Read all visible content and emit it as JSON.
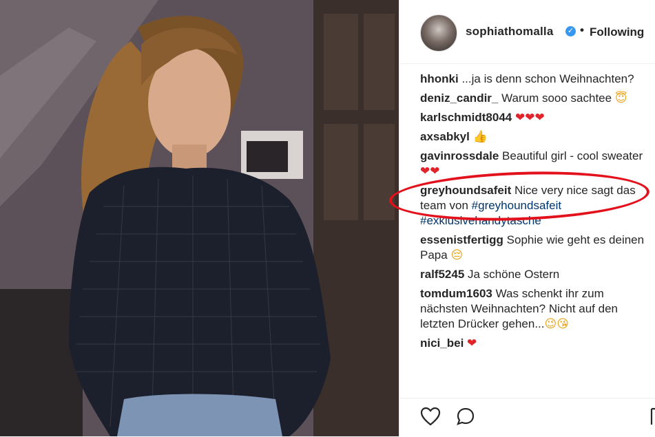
{
  "post": {
    "username": "sophiathomalla",
    "verified_mark": "✓",
    "separator": "•",
    "follow_status": "Following"
  },
  "comments": [
    {
      "user": "hhonki",
      "text": " ...ja is denn schon Weihnachten?",
      "emoji": ""
    },
    {
      "user": "deniz_candir_",
      "text": " Warum sooo sachtee ",
      "emoji": "😇"
    },
    {
      "user": "karlschmidt8044",
      "text": " ",
      "emoji": "❤❤❤"
    },
    {
      "user": "axsabkyl",
      "text": " ",
      "emoji": "👍"
    },
    {
      "user": "gavinrossdale",
      "text": " Beautiful girl - cool sweater ",
      "emoji": "❤❤"
    },
    {
      "user": "greyhoundsafeit",
      "text": " Nice very nice sagt das team von ",
      "tag1": "#greyhoundsafeit",
      "tag2": "#exklusivehandytasche"
    },
    {
      "user": "essenistfertigg",
      "text": " Sophie wie geht es deinen Papa ",
      "emoji": "😔"
    },
    {
      "user": "ralf5245",
      "text": " Ja schöne Ostern",
      "emoji": ""
    },
    {
      "user": "tomdum1603",
      "text": " Was schenkt ihr zum nächsten Weihnachten? Nicht auf den letzten Drücker gehen...",
      "emoji": "😉😘"
    },
    {
      "user": "nici_bei",
      "text": " ",
      "emoji": "❤"
    }
  ],
  "icons": {
    "like": "heart-outline-icon",
    "comment": "comment-bubble-icon",
    "save": "bookmark-icon"
  },
  "colors": {
    "text": "#262626",
    "hashtag": "#003569",
    "verified": "#3897f0",
    "highlight": "#e3111b",
    "heart": "#e0242c"
  }
}
